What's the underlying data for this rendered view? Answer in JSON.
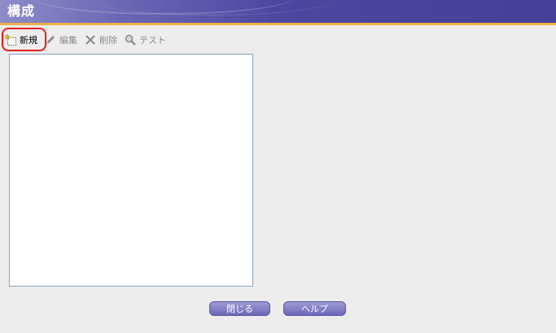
{
  "window": {
    "title": "構成"
  },
  "toolbar": {
    "new_label": "新規",
    "edit_label": "編集",
    "delete_label": "削除",
    "test_label": "テスト"
  },
  "buttons": {
    "close_label": "閉じる",
    "help_label": "ヘルプ"
  },
  "colors": {
    "accent": "#4d47a0",
    "highlight": "#e0201e",
    "gold_line": "#e8b24a"
  },
  "icons": [
    "new-item-icon",
    "pencil-icon",
    "x-icon",
    "magnifier-icon"
  ]
}
